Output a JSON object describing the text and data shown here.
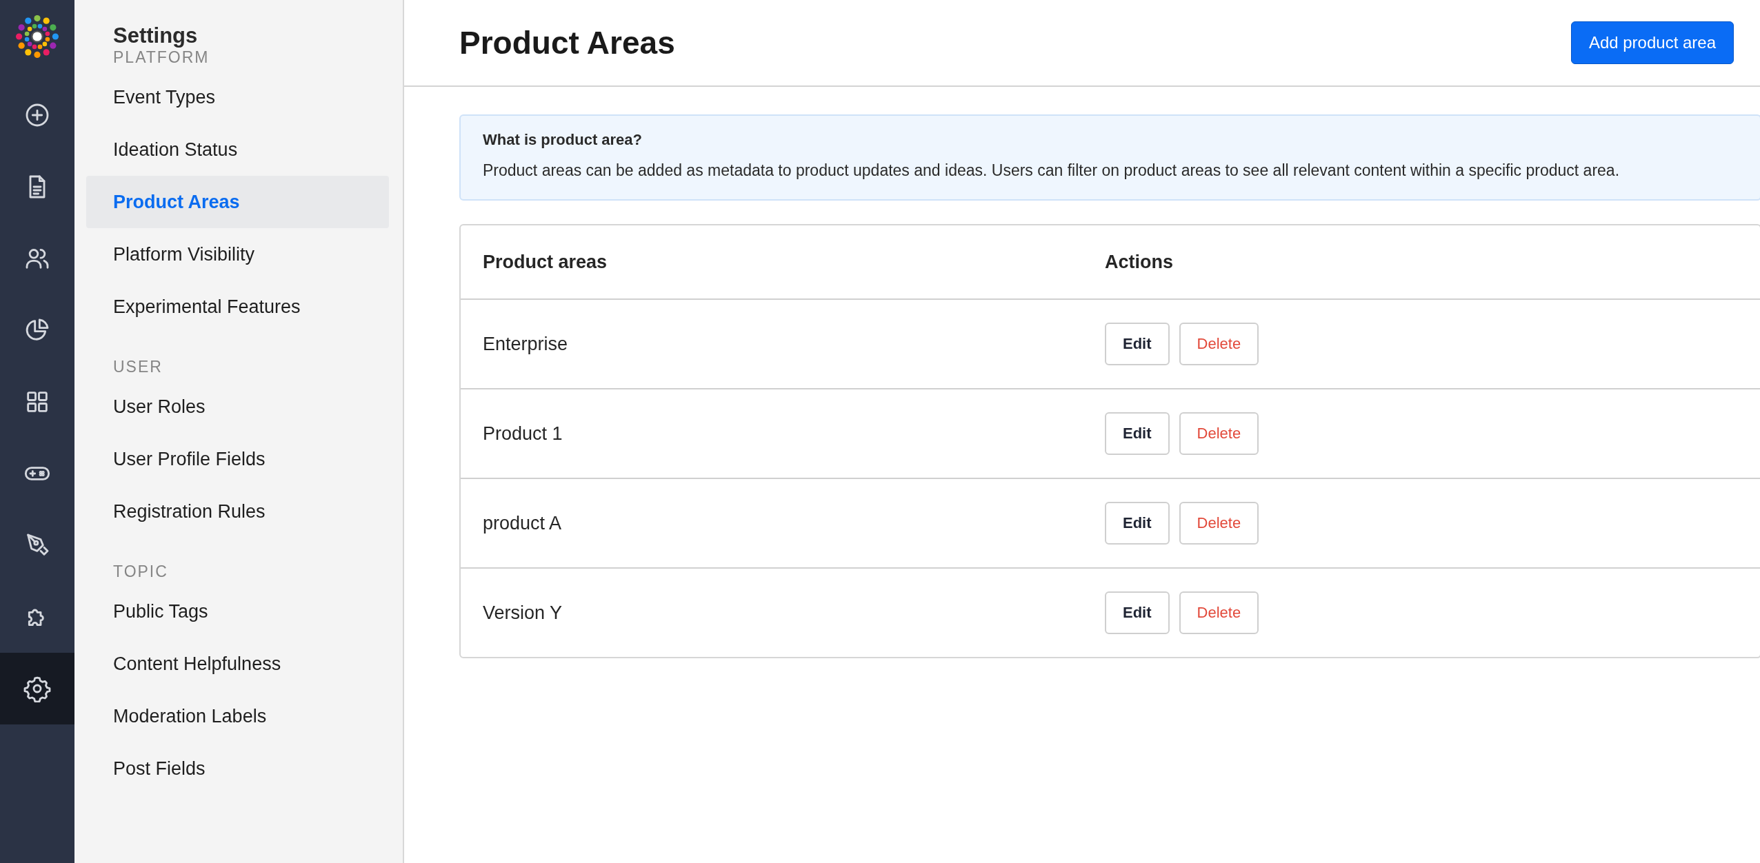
{
  "rail": [
    {
      "kind": "add",
      "selected": false
    },
    {
      "kind": "document",
      "selected": false
    },
    {
      "kind": "users",
      "selected": false
    },
    {
      "kind": "chart",
      "selected": false
    },
    {
      "kind": "grid",
      "selected": false
    },
    {
      "kind": "gamepad",
      "selected": false
    },
    {
      "kind": "pen",
      "selected": false
    },
    {
      "kind": "puzzle",
      "selected": false
    },
    {
      "kind": "settings",
      "selected": true
    }
  ],
  "sidebar": {
    "title": "Settings",
    "sections": [
      {
        "heading": "PLATFORM",
        "items": [
          {
            "label": "Event Types",
            "selected": false
          },
          {
            "label": "Ideation Status",
            "selected": false
          },
          {
            "label": "Product Areas",
            "selected": true
          },
          {
            "label": "Platform Visibility",
            "selected": false
          },
          {
            "label": "Experimental Features",
            "selected": false
          }
        ]
      },
      {
        "heading": "USER",
        "items": [
          {
            "label": "User Roles",
            "selected": false
          },
          {
            "label": "User Profile Fields",
            "selected": false
          },
          {
            "label": "Registration Rules",
            "selected": false
          }
        ]
      },
      {
        "heading": "TOPIC",
        "items": [
          {
            "label": "Public Tags",
            "selected": false
          },
          {
            "label": "Content Helpfulness",
            "selected": false
          },
          {
            "label": "Moderation Labels",
            "selected": false
          },
          {
            "label": "Post Fields",
            "selected": false
          }
        ]
      }
    ]
  },
  "header": {
    "title": "Product Areas",
    "button": "Add product area"
  },
  "info": {
    "title": "What is product area?",
    "text": "Product areas can be added as metadata to product updates and ideas. Users can filter on product areas to see all relevant content within a specific product area."
  },
  "table": {
    "columns": [
      "Product areas",
      "Actions"
    ],
    "rows": [
      {
        "name": "Enterprise",
        "actions": [
          "Edit",
          "Delete"
        ]
      },
      {
        "name": "Product 1",
        "actions": [
          "Edit",
          "Delete"
        ]
      },
      {
        "name": "product A",
        "actions": [
          "Edit",
          "Delete"
        ]
      },
      {
        "name": "Version Y",
        "actions": [
          "Edit",
          "Delete"
        ]
      }
    ]
  }
}
